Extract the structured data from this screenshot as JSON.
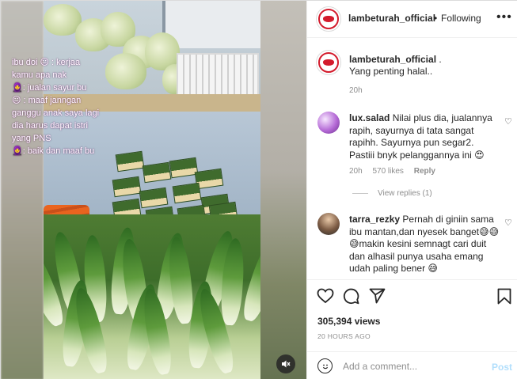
{
  "header": {
    "username": "lambeturah_official",
    "separator": "•",
    "follow_state": "Following",
    "more_icon": "ellipsis-icon"
  },
  "video": {
    "overlay_lines": [
      "ibu doi 😐 : kerjaa",
      "kamu apa nak",
      "🧕: jualan sayur bu",
      "😐 : maaf janngan",
      "ganggu anak saya lagi",
      "dia harus dapat istri",
      "yang PNS",
      "🧕: baik dan maaf bu"
    ],
    "mute_icon": "speaker-muted-icon"
  },
  "caption": {
    "username": "lambeturah_official",
    "suffix": ".",
    "text": "Yang penting halal..",
    "time": "20h"
  },
  "comments": [
    {
      "username": "lux.salad",
      "text": "Nilai plus dia, jualannya rapih, sayurnya di tata sangat rapihh. Sayurnya pun segar2. Pastiii bnyk pelanggannya ini 😍",
      "time": "20h",
      "likes": "570 likes",
      "reply": "Reply",
      "view_replies": "View replies (1)"
    },
    {
      "username": "tarra_rezky",
      "text": "Pernah di giniin sama ibu mantan,dan nyesek banget😅😅😅makin kesini semnagt cari duit dan alhasil punya usaha emang udah paling bener 😅"
    }
  ],
  "actions": {
    "like_icon": "heart-icon",
    "comment_icon": "comment-icon",
    "share_icon": "paper-plane-icon",
    "save_icon": "bookmark-icon",
    "views": "305,394 views",
    "posted": "20 HOURS AGO"
  },
  "add_comment": {
    "placeholder": "Add a comment...",
    "post_label": "Post"
  },
  "colors": {
    "brand_red": "#d31b2c",
    "post_disabled": "#b2dffc",
    "muted_text": "#8e8e8e"
  }
}
